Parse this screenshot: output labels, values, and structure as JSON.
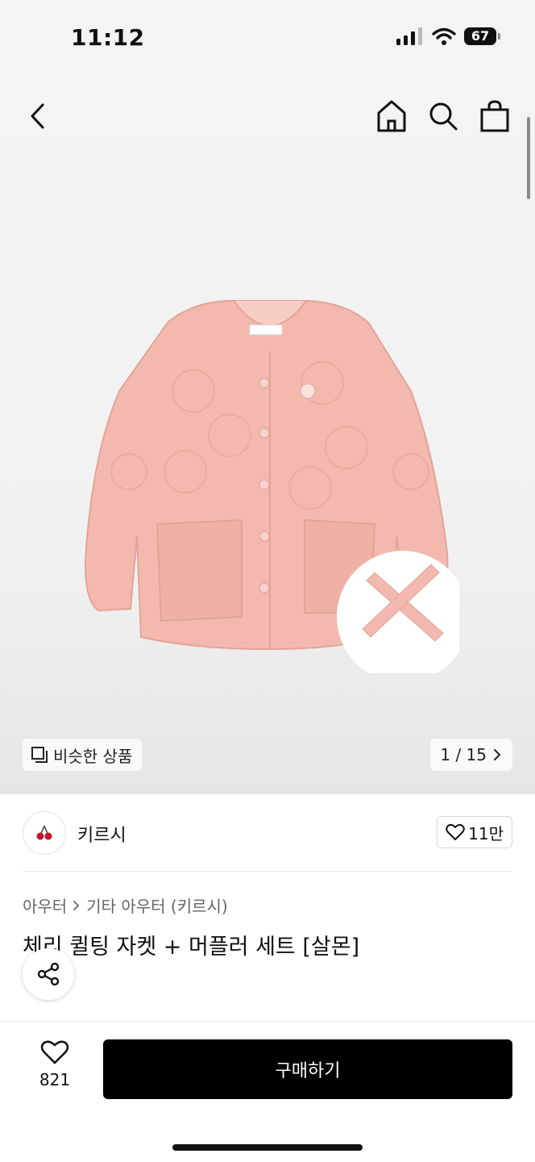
{
  "status_bar": {
    "time": "11:12",
    "battery": "67"
  },
  "icons": {
    "back": "chevron-left-icon",
    "home": "home-icon",
    "search": "search-icon",
    "bag": "shopping-bag-icon",
    "similar": "copy-stack-icon",
    "pager_next": "chevron-right-icon",
    "like": "heart-icon",
    "share": "share-icon",
    "wish": "heart-icon"
  },
  "hero": {
    "similar_label": "비슷한 상품",
    "pager": "1 / 15"
  },
  "brand": {
    "name": "키르시",
    "likes": "11만"
  },
  "product": {
    "breadcrumb": [
      "아우터",
      "기타 아우터 (키르시)"
    ],
    "title": "체리 퀼팅 자켓 + 머플러 세트 [살몬]"
  },
  "bottom_bar": {
    "wish_count": "821",
    "buy_label": "구매하기"
  },
  "colors": {
    "accent": "#000000",
    "product_pink": "#f3b9ae"
  }
}
